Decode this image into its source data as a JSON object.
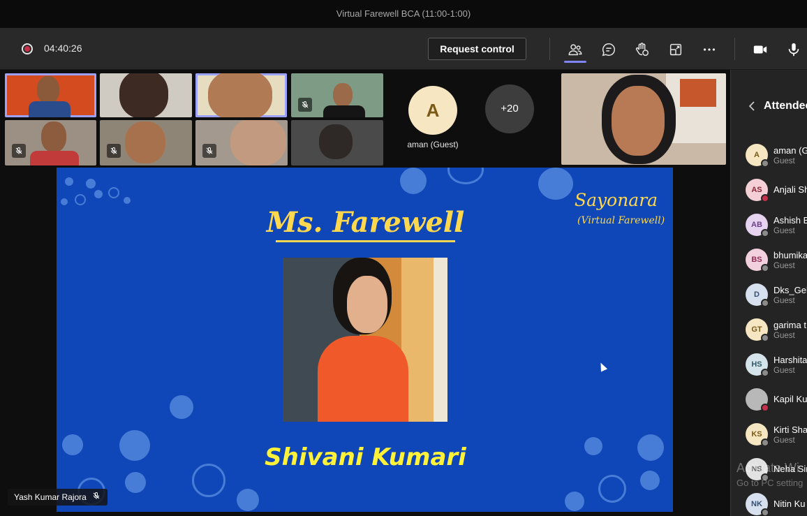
{
  "window": {
    "title": "Virtual Farewell BCA (11:00-1:00)"
  },
  "toolbar": {
    "timer": "04:40:26",
    "request_control_label": "Request control",
    "icons": [
      "participants-icon",
      "chat-icon",
      "raise-hand-icon",
      "share-tray-icon",
      "more-options-icon",
      "camera-icon",
      "microphone-icon"
    ]
  },
  "gallery": {
    "guest": {
      "initial": "A",
      "name": "aman (Guest)"
    },
    "overflow_count": "+20"
  },
  "slide": {
    "corner_title": "Sayonara",
    "corner_subtitle": "(Virtual Farewell)",
    "title": "Ms. Farewell",
    "winner_name": "Shivani Kumari"
  },
  "presenter": {
    "name": "Yash Kumar Rajora"
  },
  "attendees_panel": {
    "title": "Attendees",
    "items": [
      {
        "initials": "A",
        "name": "aman (G",
        "role": "Guest",
        "avatar_bg": "#f7e6c2",
        "avatar_fg": "#7a5a16",
        "status": "#8a8a8a"
      },
      {
        "initials": "AS",
        "name": "Anjali Sh",
        "role": "",
        "avatar_bg": "#f4d0d6",
        "avatar_fg": "#8b2337",
        "status": "#c4314b"
      },
      {
        "initials": "AB",
        "name": "Ashish B",
        "role": "Guest",
        "avatar_bg": "#e6d3ef",
        "avatar_fg": "#6b3f87",
        "status": "#8a8a8a"
      },
      {
        "initials": "BS",
        "name": "bhumika",
        "role": "Guest",
        "avatar_bg": "#f2d0dd",
        "avatar_fg": "#8e2b56",
        "status": "#8a8a8a"
      },
      {
        "initials": "D",
        "name": "Dks_Geh",
        "role": "Guest",
        "avatar_bg": "#d6e0ee",
        "avatar_fg": "#364f73",
        "status": "#8a8a8a"
      },
      {
        "initials": "GT",
        "name": "garima t",
        "role": "Guest",
        "avatar_bg": "#f7e6c2",
        "avatar_fg": "#7a5a16",
        "status": "#8a8a8a"
      },
      {
        "initials": "HS",
        "name": "Harshita",
        "role": "Guest",
        "avatar_bg": "#d4e4ea",
        "avatar_fg": "#2f5a68",
        "status": "#8a8a8a"
      },
      {
        "initials": "",
        "name": "Kapil Ku",
        "role": "",
        "avatar_bg": "#b8b8b8",
        "avatar_fg": "#333333",
        "status": "#c4314b"
      },
      {
        "initials": "KS",
        "name": "Kirti Sha",
        "role": "Guest",
        "avatar_bg": "#f7e6c2",
        "avatar_fg": "#7a5a16",
        "status": "#8a8a8a"
      },
      {
        "initials": "NS",
        "name": "Neha Sin",
        "role": "",
        "avatar_bg": "#e2e2e2",
        "avatar_fg": "#555555",
        "status": "#8a8a8a"
      },
      {
        "initials": "NK",
        "name": "Nitin Ku",
        "role": "",
        "avatar_bg": "#d6e0ee",
        "avatar_fg": "#364f73",
        "status": "#8a8a8a"
      }
    ]
  },
  "watermark": {
    "line1": "Activate Wi",
    "line2": "Go to PC setting"
  }
}
